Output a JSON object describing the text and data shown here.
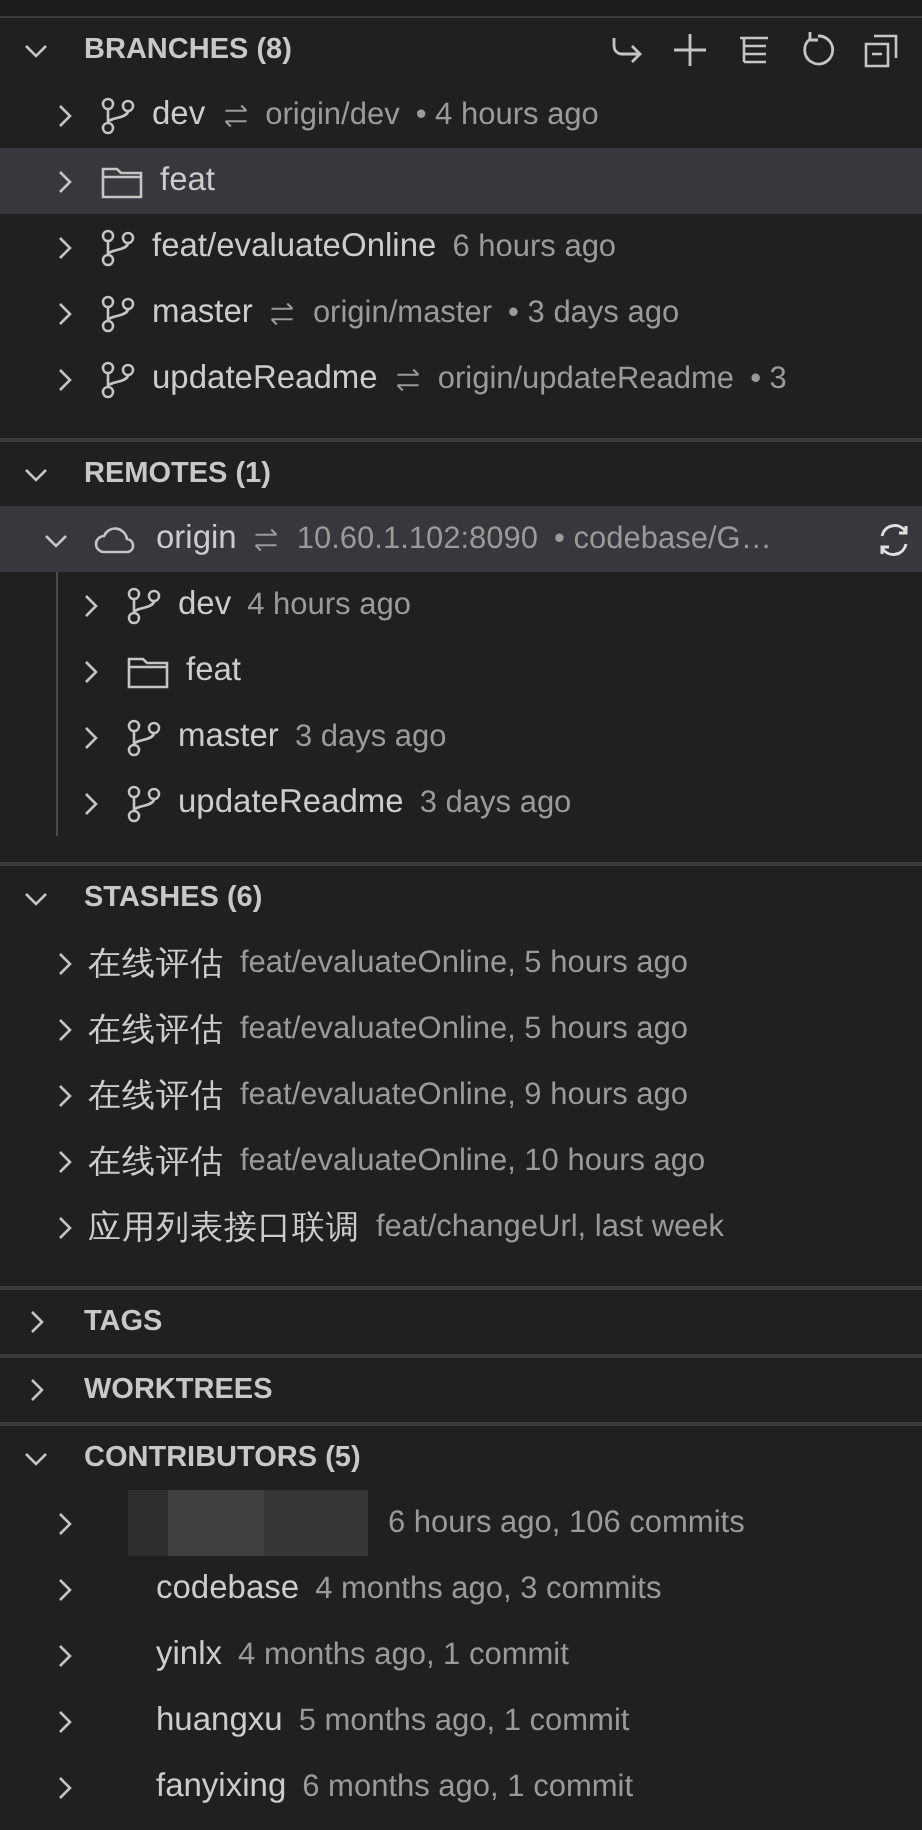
{
  "sections": [
    {
      "title": "BRANCHES (8)",
      "expanded": true,
      "actions": [
        {
          "kind": "switch"
        },
        {
          "kind": "add"
        },
        {
          "kind": "view"
        },
        {
          "kind": "refresh"
        },
        {
          "kind": "collapse"
        }
      ],
      "items": [
        {
          "kind": "branch",
          "label": "dev",
          "upstream": "origin/dev",
          "detail": "• 4 hours ago",
          "selected": false,
          "expanded": false
        },
        {
          "kind": "folder",
          "label": "feat",
          "selected": true,
          "expanded": false
        },
        {
          "kind": "branch",
          "label": "feat/evaluateOnline",
          "detail": "6 hours ago",
          "selected": false,
          "expanded": false
        },
        {
          "kind": "branch",
          "label": "master",
          "upstream": "origin/master",
          "detail": "• 3 days ago",
          "selected": false,
          "expanded": false
        },
        {
          "kind": "branch",
          "label": "updateReadme",
          "upstream": "origin/updateReadme",
          "detail": "• 3",
          "selected": false,
          "expanded": false
        }
      ]
    },
    {
      "title": "REMOTES (1)",
      "expanded": true,
      "items": [
        {
          "kind": "remote",
          "label": "origin",
          "upstream": "10.60.1.102:8090",
          "detail": "• codebase/G…",
          "selected": true,
          "expanded": true,
          "children": [
            {
              "kind": "branch",
              "label": "dev",
              "detail": "4 hours ago",
              "selected": false,
              "expanded": false
            },
            {
              "kind": "folder",
              "label": "feat",
              "selected": false,
              "expanded": false
            },
            {
              "kind": "branch",
              "label": "master",
              "detail": "3 days ago",
              "selected": false,
              "expanded": false
            },
            {
              "kind": "branch",
              "label": "updateReadme",
              "detail": "3 days ago",
              "selected": false,
              "expanded": false
            }
          ]
        }
      ]
    },
    {
      "title": "STASHES (6)",
      "expanded": true,
      "items": [
        {
          "kind": "stash",
          "label": "在线评估",
          "detail": "feat/evaluateOnline, 5 hours ago",
          "selected": false,
          "expanded": false
        },
        {
          "kind": "stash",
          "label": "在线评估",
          "detail": "feat/evaluateOnline, 5 hours ago",
          "selected": false,
          "expanded": false
        },
        {
          "kind": "stash",
          "label": "在线评估",
          "detail": "feat/evaluateOnline, 9 hours ago",
          "selected": false,
          "expanded": false
        },
        {
          "kind": "stash",
          "label": "在线评估",
          "detail": "feat/evaluateOnline, 10 hours ago",
          "selected": false,
          "expanded": false
        },
        {
          "kind": "stash",
          "label": "应用列表接口联调",
          "detail": "feat/changeUrl, last week",
          "selected": false,
          "expanded": false
        }
      ]
    },
    {
      "title": "TAGS",
      "expanded": false
    },
    {
      "title": "WORKTREES",
      "expanded": false
    },
    {
      "title": "CONTRIBUTORS (5)",
      "expanded": true,
      "items": [
        {
          "kind": "redacted",
          "detail": "6 hours ago, 106 commits",
          "selected": false,
          "expanded": false
        },
        {
          "kind": "contributor",
          "label": "codebase",
          "detail": "4 months ago, 3 commits",
          "selected": false,
          "expanded": false
        },
        {
          "kind": "contributor",
          "label": "yinlx",
          "detail": "4 months ago, 1 commit",
          "selected": false,
          "expanded": false
        },
        {
          "kind": "contributor",
          "label": "huangxu",
          "detail": "5 months ago, 1 commit",
          "selected": false,
          "expanded": false
        },
        {
          "kind": "contributor",
          "label": "fanyixing",
          "detail": "6 months ago, 1 commit",
          "selected": false,
          "expanded": false
        }
      ]
    }
  ]
}
